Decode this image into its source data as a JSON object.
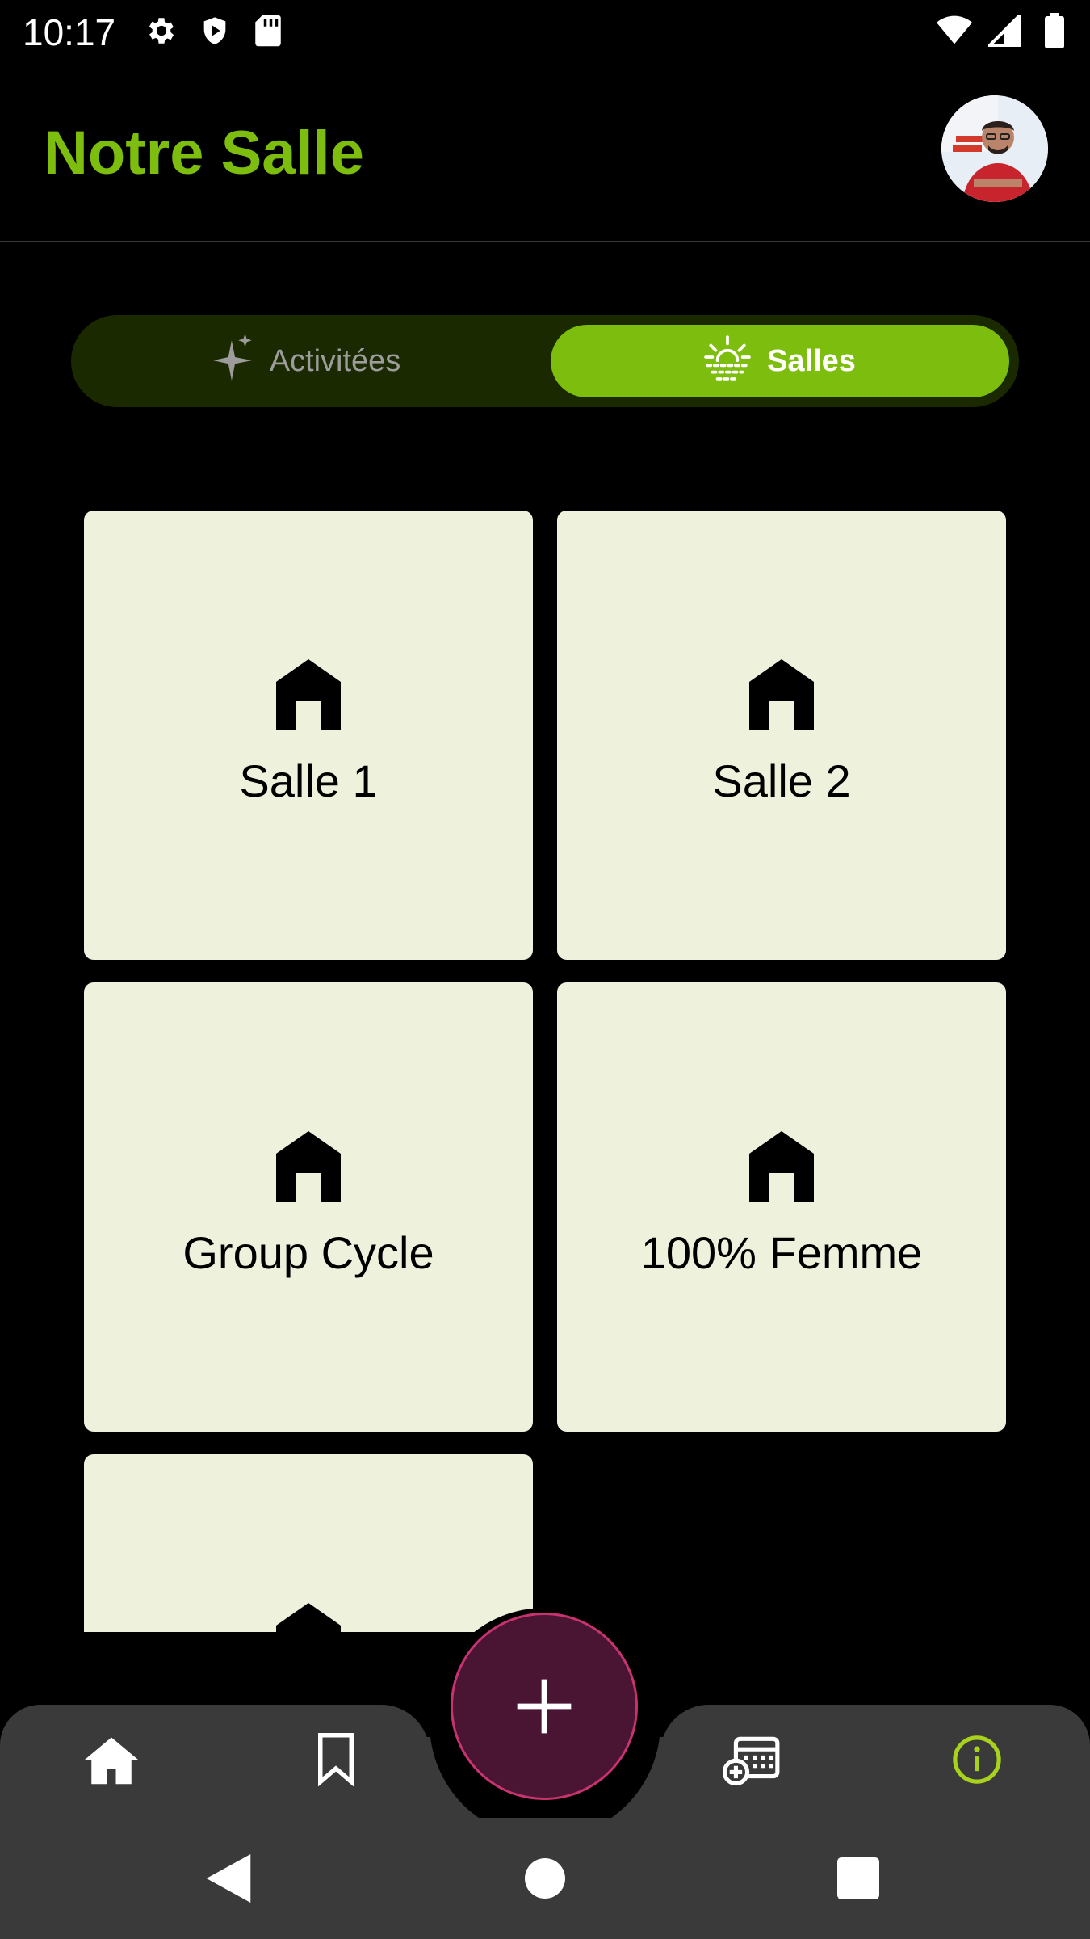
{
  "status_bar": {
    "time": "10:17",
    "icons_left": [
      "settings-icon",
      "shield-icon",
      "sd-card-icon"
    ],
    "icons_right": [
      "wifi-icon",
      "cellular-signal-icon",
      "battery-icon"
    ]
  },
  "header": {
    "title": "Notre Salle",
    "avatar": "profile-avatar"
  },
  "segmented": {
    "activities_label": "Activitées",
    "activities_icon": "sparkle-icon",
    "salles_label": "Salles",
    "salles_icon": "sunrise-icon",
    "selected": "Salles"
  },
  "rooms": [
    {
      "label": "Salle 1",
      "icon": "house-icon"
    },
    {
      "label": "Salle 2",
      "icon": "house-icon"
    },
    {
      "label": "Group Cycle",
      "icon": "house-icon"
    },
    {
      "label": "100% Femme",
      "icon": "house-icon"
    },
    {
      "label": "",
      "icon": "house-icon"
    }
  ],
  "bottom_nav": {
    "items": [
      "home-icon",
      "bookmark-icon",
      "calendar-add-icon",
      "info-icon"
    ],
    "fab_icon": "plus-icon",
    "active": "info-icon"
  },
  "system_nav": [
    "back-icon",
    "home-circle-icon",
    "recents-icon"
  ],
  "colors": {
    "accent": "#7dbd0d",
    "toggle_bg": "#1b2900",
    "card_bg": "#eef1dc",
    "fab_bg": "#4a1533",
    "fab_border": "#c8336f",
    "nav_bg": "#3a3a3a",
    "info_icon": "#a8d21c"
  }
}
